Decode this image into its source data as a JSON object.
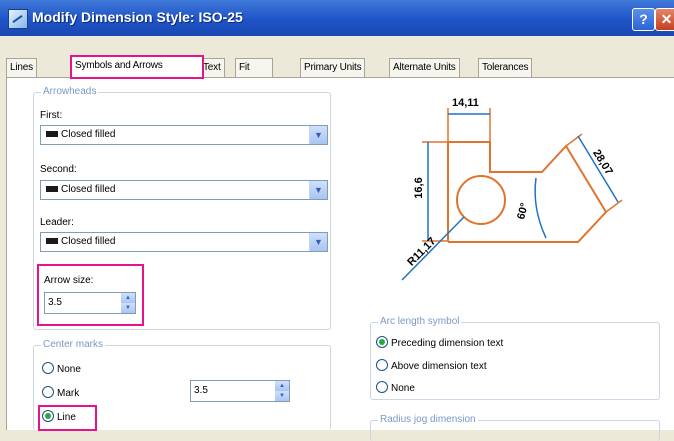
{
  "window": {
    "title": "Modify Dimension Style: ISO-25",
    "help_label": "?",
    "close_label": "✕",
    "icon": "dimension-style-icon"
  },
  "tabs": [
    {
      "label": "Lines"
    },
    {
      "label": "Symbols and Arrows",
      "active": true
    },
    {
      "label": "Text"
    },
    {
      "label": "Fit"
    },
    {
      "label": "Primary Units"
    },
    {
      "label": "Alternate Units"
    },
    {
      "label": "Tolerances"
    }
  ],
  "arrowheads": {
    "title": "Arrowheads",
    "first_label": "First:",
    "first_value": "Closed filled",
    "second_label": "Second:",
    "second_value": "Closed filled",
    "leader_label": "Leader:",
    "leader_value": "Closed filled",
    "arrow_size_label": "Arrow size:",
    "arrow_size_value": "3.5"
  },
  "center_marks": {
    "title": "Center marks",
    "options": [
      "None",
      "Mark",
      "Line"
    ],
    "selected": "Line",
    "size_value": "3.5"
  },
  "preview": {
    "dim_top": "14,11",
    "dim_left": "16,6",
    "dim_right": "28,07",
    "dim_angle": "60°",
    "dim_radius": "R11,17"
  },
  "arc_length_symbol": {
    "title": "Arc length symbol",
    "options": [
      "Preceding dimension text",
      "Above dimension text",
      "None"
    ],
    "selected": "Preceding dimension text"
  },
  "radius_jog": {
    "title": "Radius jog dimension"
  },
  "colors": {
    "highlight": "#e5148a",
    "title_bar": "#2a5fcf",
    "object": "#e0742e",
    "dimension": "#1e73c8"
  }
}
